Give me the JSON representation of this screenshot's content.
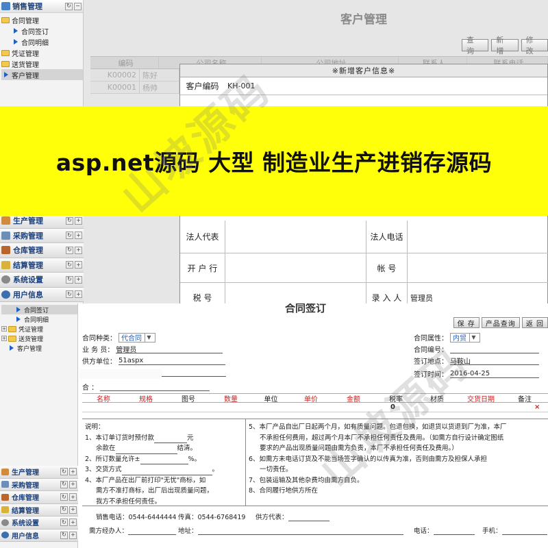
{
  "top": {
    "nav_header": "销售管理",
    "tree": [
      {
        "label": "合同管理",
        "kind": "folder"
      },
      {
        "label": "合同签订",
        "kind": "leaf"
      },
      {
        "label": "合同明细",
        "kind": "leaf"
      },
      {
        "label": "凭证管理",
        "kind": "folder"
      },
      {
        "label": "送货管理",
        "kind": "folder"
      },
      {
        "label": "客户管理",
        "kind": "leaf-selected"
      }
    ],
    "sections": [
      "生产管理",
      "采购管理",
      "仓库管理",
      "结算管理",
      "系统设置",
      "用户信息"
    ],
    "page_title": "客户管理",
    "toolbar": [
      "查 询",
      "新 增",
      "修 改"
    ],
    "grid_headers": [
      "编码",
      "公司名称",
      "公司地址",
      "联系人",
      "联系电话"
    ],
    "grid_rows": [
      [
        "K00002",
        "陈好"
      ],
      [
        "K00001",
        "杨帅"
      ]
    ],
    "dialog": {
      "title": "※新增客户信息※",
      "code_label": "客户编码",
      "code_value": "KH-001",
      "legal_rep": "法人代表",
      "legal_phone": "法人电话",
      "bank": "开 户 行",
      "account": "帐 号",
      "tax": "税 号",
      "entered_by": "录 入 人",
      "entered_by_value": "管理员"
    }
  },
  "banner_text": "asp.net源码 大型 制造业生产进销存源码",
  "watermark": "山坡源码",
  "bottom": {
    "tree": [
      "合同签订",
      "合同明细",
      "凭证管理",
      "送货管理",
      "客户管理"
    ],
    "sections": [
      "生产管理",
      "采购管理",
      "仓库管理",
      "结算管理",
      "系统设置",
      "用户信息"
    ],
    "title_fragment": "合同签订",
    "toolbar": [
      "保 存",
      "产品查询",
      "返 回"
    ],
    "contract_type_label": "合同种类：",
    "contract_type_value": "代合同",
    "salesman_label": "业 务 员：",
    "salesman_value": "管理员",
    "supplier_label": "供方单位：",
    "supplier_value": "51aspx",
    "agreement_label": "合同属性：",
    "agreement_value": "内贸",
    "contract_no_label": "合同编号：",
    "sign_place_label": "签订地点：",
    "sign_place_value": "马鞍山",
    "sign_time_label": "签订时间：",
    "sign_time_value": "2016-04-25",
    "customer_label": "合 ：",
    "table_headers": [
      {
        "text": "名称",
        "color": "#cc1f1f"
      },
      {
        "text": "规格",
        "color": "#cc1f1f"
      },
      {
        "text": "图号",
        "color": "#222222"
      },
      {
        "text": "数量",
        "color": "#cc1f1f"
      },
      {
        "text": "单位",
        "color": "#222222"
      },
      {
        "text": "单价",
        "color": "#cc1f1f"
      },
      {
        "text": "金额",
        "color": "#cc1f1f"
      },
      {
        "text": "税率",
        "color": "#222222"
      },
      {
        "text": "材质",
        "color": "#222222"
      },
      {
        "text": "交货日期",
        "color": "#cc1f1f"
      },
      {
        "text": "备注",
        "color": "#222222"
      }
    ],
    "total_value": "0",
    "remove_mark": "×",
    "notes_left": [
      "说明：",
      "1、本订单订货时预付款",
      "余款在",
      "2、所订数量允许±",
      "3、交货方式",
      "4、本厂产品在出厂前打印\"无忧\"商标，如",
      "需方不准打商标，出厂后出现质量问题，",
      "我方不承担任何责任。"
    ],
    "notes_left_suffix": [
      "元",
      "结清。",
      "%。",
      "。"
    ],
    "notes_right": [
      "5、本厂产品自出厂日起两个月，如有质量问题。包退包换，如退货以货退到厂为准，本厂",
      "不承担任何费用，超过两个月本厂不承担任何责任及费用。（如需方自行设计确定图纸",
      "要求的产品出现质量问题由需方负责，本厂不承担任何责任及费用。）",
      "6、如需方未电话订货及不能当场签字确认的以传真为准，否则由需方及担保人承担",
      "一切责任。",
      "7、包装运输及其他杂费均由需方自负。",
      "8、合同履行地供方所在"
    ],
    "sales_phone": "销售电话：0544-6444444",
    "fax": "传真：0544-6768419",
    "supplier_rep": "供方代表：",
    "buyer_agent": "需方经办人：",
    "address": "地址：",
    "phone": "电话：",
    "mobile": "手机："
  }
}
